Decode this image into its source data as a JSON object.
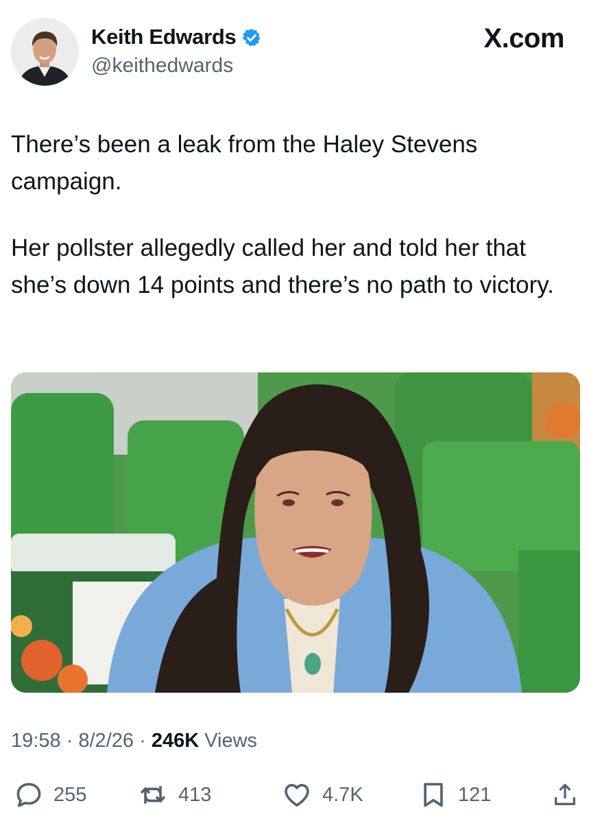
{
  "author": {
    "name": "Keith Edwards",
    "handle": "@keithedwards",
    "verified": true,
    "verified_color": "#1d9bf0"
  },
  "brand": "X.com",
  "tweet": {
    "paragraphs": [
      "There’s been a leak from the Haley Stevens campaign.",
      "Her pollster allegedly called her and told her that she’s down 14 points and there’s no path to victory."
    ]
  },
  "meta": {
    "time": "19:58",
    "separator": "·",
    "date": "8/2/26",
    "views_count": "246K",
    "views_label": "Views"
  },
  "actions": {
    "replies": "255",
    "reposts": "413",
    "likes": "4.7K",
    "bookmarks": "121"
  },
  "icons": [
    "verified-badge-icon",
    "reply-icon",
    "repost-icon",
    "like-icon",
    "bookmark-icon",
    "share-icon"
  ],
  "colors": {
    "text": "#0f1419",
    "secondary": "#536471",
    "accent": "#1d9bf0"
  }
}
